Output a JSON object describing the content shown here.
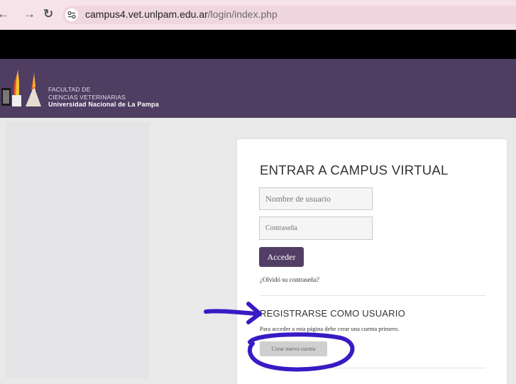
{
  "browser": {
    "url_host": "campus4.vet.unlpam.edu.ar",
    "url_path": "/login/index.php"
  },
  "header": {
    "faculty_line1": "FACULTAD DE",
    "faculty_line2": "CIENCIAS VETERINARIAS",
    "university": "Universidad Nacional de La Pampa"
  },
  "login": {
    "title": "ENTRAR A CAMPUS VIRTUAL",
    "username_placeholder": "Nombre de usuario",
    "password_placeholder": "Contraseña",
    "submit_label": "Acceder",
    "forgot_link": "¿Olvidó su contraseña?"
  },
  "register": {
    "title": "REGISTRARSE COMO USUARIO",
    "text": "Para acceder a esta página debe crear una cuenta primero.",
    "button_label": "Crear nueva cuenta"
  },
  "colors": {
    "header": "#4f3d62",
    "primary_button": "#533f66",
    "annotation": "#3a1ac4"
  },
  "icons": [
    "back-arrow-icon",
    "forward-arrow-icon",
    "reload-icon",
    "site-settings-icon"
  ]
}
